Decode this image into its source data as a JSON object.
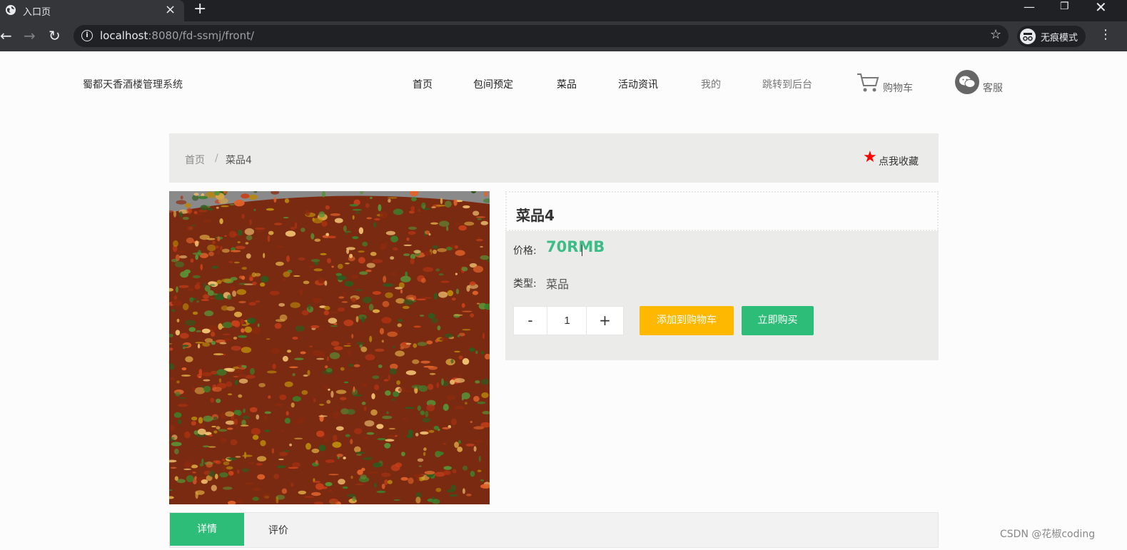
{
  "browser": {
    "tab_title": "入口页",
    "url_host": "localhost",
    "url_rest": ":8080/fd-ssmj/front/",
    "incognito_label": "无痕模式"
  },
  "header": {
    "site_name": "蜀都天香酒楼管理系统",
    "nav": [
      "首页",
      "包间预定",
      "菜品",
      "活动资讯",
      "我的",
      "跳转到后台"
    ],
    "cart_label": "购物车",
    "service_label": "客服"
  },
  "breadcrumb": {
    "home": "首页",
    "separator": "/",
    "current": "菜品4",
    "favorite_label": "点我收藏"
  },
  "product": {
    "title": "菜品4",
    "price_label": "价格:",
    "price_value": "70RMB",
    "type_label": "类型:",
    "type_value": "菜品",
    "qty_minus": "-",
    "qty_value": "1",
    "qty_plus": "+",
    "add_to_cart": "添加到购物车",
    "buy_now": "立即购买"
  },
  "tabs": {
    "detail": "详情",
    "review": "评价"
  },
  "watermark": "CSDN @花椒coding",
  "colors": {
    "accent_green": "#2dbd78",
    "price_green": "#3cbc86",
    "cart_yellow": "#ffb800",
    "favorite_red": "#ff0000"
  },
  "icons": [
    "globe-icon",
    "close-icon",
    "plus-icon",
    "back-icon",
    "forward-icon",
    "reload-icon",
    "info-icon",
    "star-icon",
    "incognito-icon",
    "menu-icon",
    "cart-icon",
    "wechat-icon",
    "favorite-star-icon"
  ]
}
